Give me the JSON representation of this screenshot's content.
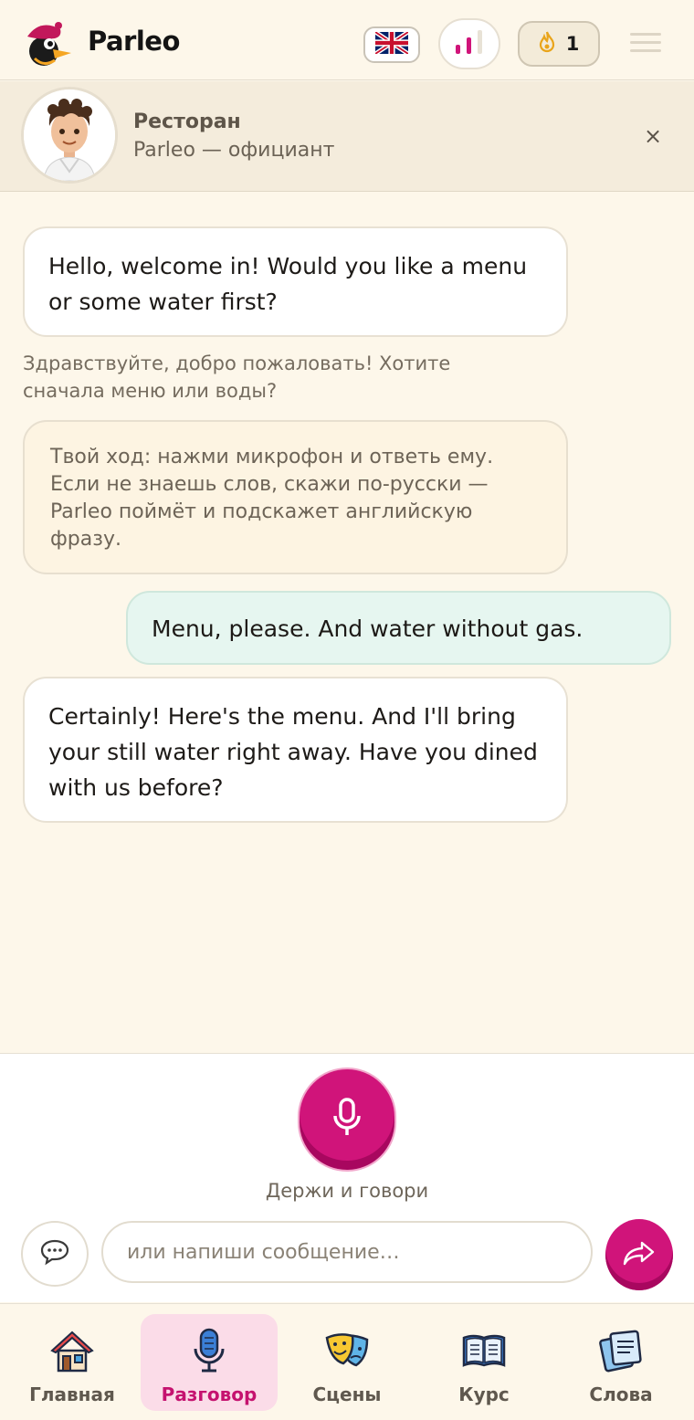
{
  "header": {
    "brand": "Parleo",
    "language_icon": "uk-flag-icon",
    "progress_icon": "bar-chart-icon",
    "streak_icon": "flame-icon",
    "streak_count": "1",
    "menu_icon": "hamburger-icon"
  },
  "scene": {
    "title": "Ресторан",
    "subtitle": "Parleo — официант",
    "close_label": "×"
  },
  "chat": {
    "bot_message_1": "Hello, welcome in! Would you like a menu or some water first?",
    "translation_1": "Здравствуйте, добро пожаловать! Хотите сначала меню или воды?",
    "hint": "Твой ход: нажми микрофон и ответь ему. Если не знаешь слов, скажи по-русски — Parleo поймёт и подскажет английскую фразу.",
    "user_message_1": "Menu, please. And water without gas.",
    "bot_message_2": "Certainly! Here's the menu. And I'll bring your still water right away. Have you dined with us before?"
  },
  "composer": {
    "mic_label": "Держи и говори",
    "input_placeholder": "или напиши сообщение…",
    "input_value": ""
  },
  "nav": {
    "items": [
      {
        "label": "Главная",
        "icon": "house-icon"
      },
      {
        "label": "Разговор",
        "icon": "microphone-icon"
      },
      {
        "label": "Сцены",
        "icon": "theater-masks-icon"
      },
      {
        "label": "Курс",
        "icon": "open-book-icon"
      },
      {
        "label": "Слова",
        "icon": "word-cards-icon"
      }
    ],
    "active_index": 1
  },
  "colors": {
    "accent": "#d0147a",
    "background": "#fdf7ea",
    "user_bubble": "#e6f6f0",
    "active_nav_bg": "#fbdce8"
  }
}
